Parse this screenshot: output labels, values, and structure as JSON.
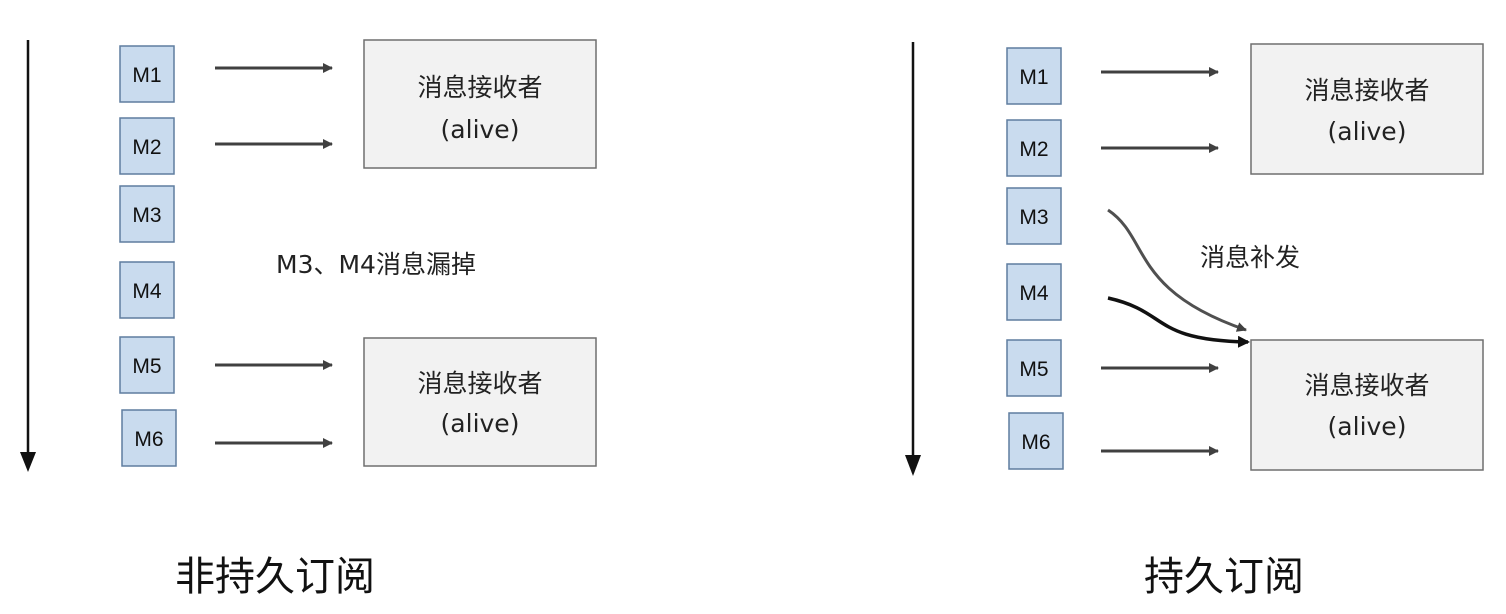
{
  "left_panel": {
    "messages": [
      "M1",
      "M2",
      "M3",
      "M4",
      "M5",
      "M6"
    ],
    "receiver_top": {
      "line1": "消息接收者",
      "line2": "(alive)"
    },
    "receiver_bottom": {
      "line1": "消息接收者",
      "line2": "(alive)"
    },
    "note": "M3、M4消息漏掉",
    "caption": "非持久订阅"
  },
  "right_panel": {
    "messages": [
      "M1",
      "M2",
      "M3",
      "M4",
      "M5",
      "M6"
    ],
    "receiver_top": {
      "line1": "消息接收者",
      "line2": "(alive)"
    },
    "receiver_bottom": {
      "line1": "消息接收者",
      "line2": "(alive)"
    },
    "note": "消息补发",
    "caption": "持久订阅"
  },
  "colors": {
    "message_fill": "#c9dbee",
    "message_border": "#5f7d9f",
    "receiver_fill": "#f2f2f2",
    "arrow": "#404040"
  }
}
